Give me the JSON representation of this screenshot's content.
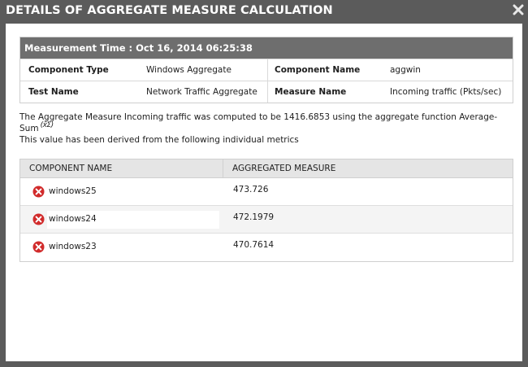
{
  "dialog": {
    "title": "DETAILS OF AGGREGATE MEASURE CALCULATION",
    "close_icon": "close-icon"
  },
  "details": {
    "measurement_time": "Measurement Time : Oct 16, 2014 06:25:38",
    "component_type_label": "Component Type",
    "component_type_value": "Windows Aggregate",
    "component_name_label": "Component Name",
    "component_name_value": "aggwin",
    "test_name_label": "Test Name",
    "test_name_value": "Network Traffic Aggregate",
    "measure_name_label": "Measure Name",
    "measure_name_value": "Incoming traffic (Pkts/sec)"
  },
  "summary": {
    "line1": "The Aggregate Measure Incoming traffic was computed to be 1416.6853 using the aggregate function Average-",
    "line2": "Sum",
    "formula_icon": "(x̄Σ)",
    "line3": "This value has been derived from the following individual metrics"
  },
  "metrics": {
    "col_component": "COMPONENT NAME",
    "col_measure": "AGGREGATED MEASURE",
    "rows": [
      {
        "component": "windows25",
        "value": "473.726",
        "status_icon": "error-icon"
      },
      {
        "component": "windows24",
        "value": "472.1979",
        "status_icon": "error-icon"
      },
      {
        "component": "windows23",
        "value": "470.7614",
        "status_icon": "error-icon"
      }
    ]
  },
  "colors": {
    "overlay": "#5b5b5b",
    "header_bar": "#6e6e6e",
    "error_red": "#d12b2b"
  }
}
